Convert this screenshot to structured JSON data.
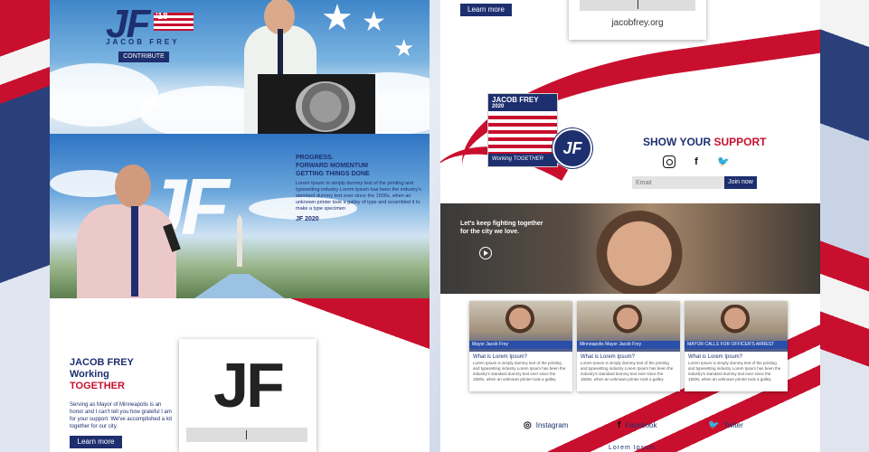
{
  "left": {
    "hero1": {
      "logo_jf": "JF",
      "logo_year": "'18",
      "logo_name": "JACOB FREY",
      "contribute_label": "CONTRIBUTE"
    },
    "hero2": {
      "big_jf": "JF",
      "tagline_1": "PROGRESS.",
      "tagline_2": "FORWARD MOMENTUM",
      "tagline_3": "GETTING THINGS DONE",
      "body": "Lorem Ipsum is simply dummy text of the printing and typesetting industry Lorem Ipsum has been the industry's standard dummy text ever since the 1500s, when an unknown printer took a galley of type and scrambled it to make a type specimen",
      "jf2020": "JF 2020"
    },
    "section3": {
      "heading_1": "JACOB FREY",
      "heading_2": "Working",
      "heading_3": "TOGETHER",
      "paragraph": "Serving as Mayor of Minneapolis is an honor and I can't tell you how grateful I am for your support. We've accomplished a lot together for our city.",
      "learn_more": "Learn more",
      "card_jf": "JF"
    }
  },
  "right": {
    "learn_more": "Learn more",
    "site": "jacobfrey.org",
    "poster": {
      "title": "JACOB FREY",
      "year": "2020",
      "footer": "Working TOGETHER",
      "badge": "JF"
    },
    "support": {
      "prefix": "SHOW YOUR ",
      "emph": "SUPPORT"
    },
    "email_placeholder": "Email",
    "join_label": "Join now",
    "video": {
      "line_1": "Let's keep fighting together",
      "line_2": "for the city we love."
    },
    "news": [
      {
        "ticker": "Mayor Jacob Frey",
        "title": "What is Lorem Ipsum?",
        "desc": "Lorem Ipsum is simply dummy text of the printing and typesetting industry Lorem Ipsum has been the industry's standard dummy text ever since the 1500s, when an unknown printer took a galley."
      },
      {
        "ticker": "Minneapolis Mayor Jacob Frey",
        "title": "What is Lorem Ipsum?",
        "desc": "Lorem Ipsum is simply dummy text of the printing and typesetting industry Lorem Ipsum has been the industry's standard dummy text ever since the 1500s, when an unknown printer took a galley."
      },
      {
        "ticker": "MAYOR CALLS FOR OFFICER'S ARREST",
        "title": "What is Lorem Ipsum?",
        "desc": "Lorem Ipsum is simply dummy text of the printing and typesetting industry Lorem Ipsum has been the industry's standard dummy text ever since the 1500s, when an unknown printer took a galley."
      }
    ],
    "social": {
      "instagram": "Instagram",
      "facebook": "Facebook",
      "twitter": "Twiter"
    },
    "bottom_text": "Lorem Ipsum"
  },
  "colors": {
    "navy": "#1d2f6f",
    "red": "#c8102e"
  }
}
